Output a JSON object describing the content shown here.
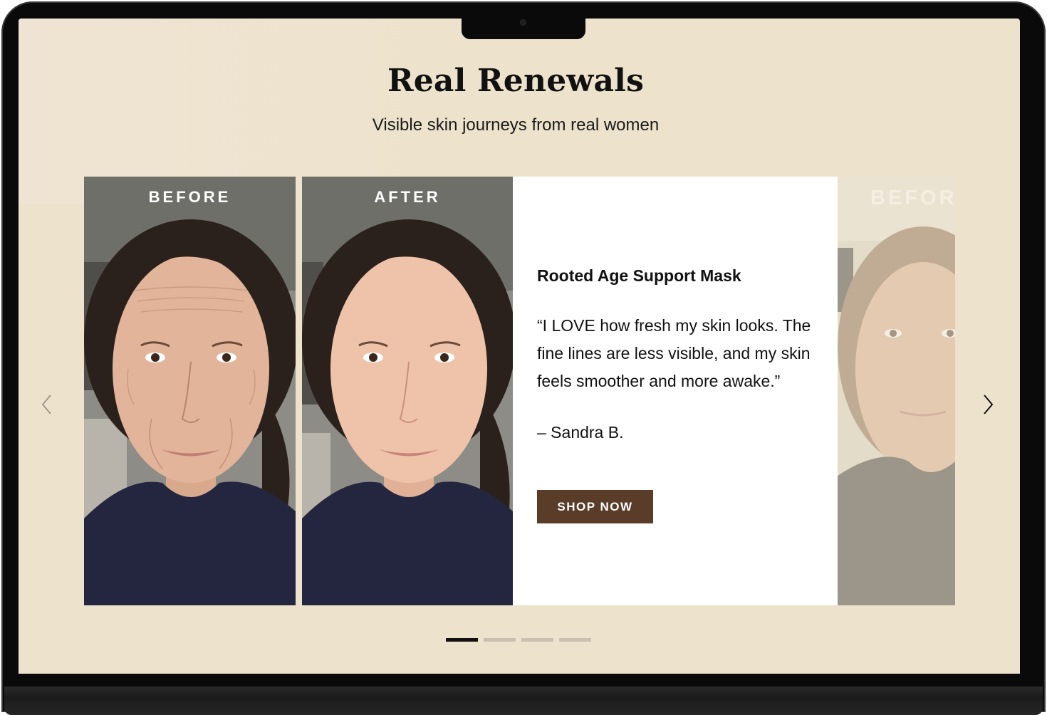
{
  "section": {
    "title": "Real Renewals",
    "subtitle": "Visible skin journeys from real women"
  },
  "slides": [
    {
      "before_label": "BEFORE",
      "after_label": "AFTER",
      "product": "Rooted Age Support Mask",
      "quote": "“I LOVE how fresh my skin looks. The fine lines are less visible, and my skin feels smoother and more awake.”",
      "author": "– Sandra B.",
      "cta": "SHOP NOW"
    },
    {
      "before_label": "BEFORE"
    }
  ],
  "carousel": {
    "prev_icon": "chevron-left-icon",
    "next_icon": "chevron-right-icon",
    "dot_count": 4,
    "active_dot": 1
  },
  "colors": {
    "screen_bg": "#ede3cc",
    "card_bg": "#ffffff",
    "cta_bg": "#5a3d28",
    "dot_active": "#111111",
    "dot_inactive": "#c9c0b2"
  }
}
